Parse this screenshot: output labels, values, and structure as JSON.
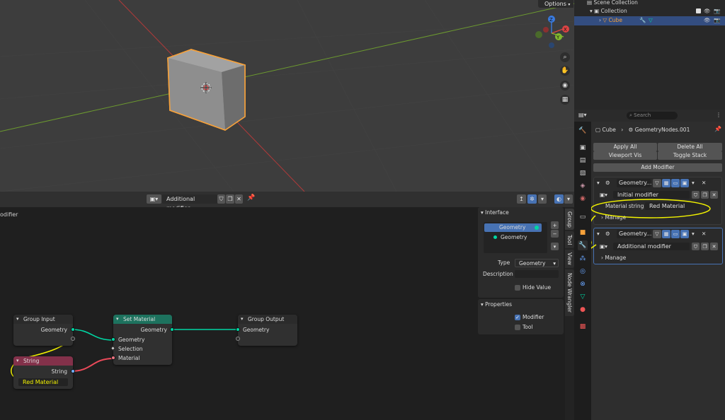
{
  "viewport": {
    "options_label": "Options"
  },
  "gizmo": {
    "x": "X",
    "y": "Y",
    "z": "Z"
  },
  "node_editor_header": {
    "tree_name": "Additional modifier"
  },
  "node_editor": {
    "left_label": "odifier"
  },
  "nodes": {
    "group_input": {
      "title": "Group Input",
      "output": "Geometry"
    },
    "string": {
      "title": "String",
      "output": "String",
      "value": "Red Material"
    },
    "set_material": {
      "title": "Set Material",
      "out": "Geometry",
      "in_geometry": "Geometry",
      "in_selection": "Selection",
      "in_material": "Material"
    },
    "group_output": {
      "title": "Group Output",
      "in_geometry": "Geometry"
    }
  },
  "npanel": {
    "interface_title": "Interface",
    "items": [
      "Geometry",
      "Geometry"
    ],
    "type_label": "Type",
    "type_value": "Geometry",
    "description_label": "Description",
    "hide_value_label": "Hide Value",
    "properties_title": "Properties",
    "modifier_label": "Modifier",
    "tool_label": "Tool"
  },
  "ntabs": [
    "Group",
    "Tool",
    "View",
    "Node Wrangler"
  ],
  "outliner": {
    "scene_collection": "Scene Collection",
    "collection": "Collection",
    "cube": "Cube"
  },
  "properties": {
    "search_placeholder": "Search",
    "breadcrumb_object": "Cube",
    "breadcrumb_modifier": "GeometryNodes.001",
    "apply_all": "Apply All",
    "delete_all": "Delete All",
    "viewport_vis": "Viewport Vis",
    "toggle_stack": "Toggle Stack",
    "add_modifier": "Add Modifier",
    "mod1_name": "Geometry...",
    "mod1_tree": "Initial modifier",
    "material_string_label": "Material string",
    "material_string_value": "Red Material",
    "manage": "Manage",
    "mod2_name": "Geometry...",
    "mod2_tree": "Additional modifier",
    "manage2": "Manage"
  },
  "colors": {
    "accent_blue": "#4772b3",
    "selection_orange": "#f6a13a",
    "geometry_socket": "#00d6a3",
    "string_socket": "#70b2ff",
    "material_socket": "#eb7582",
    "set_material_header": "#1d725e",
    "string_header": "#83314a",
    "annotation_yellow": "#f2f200"
  }
}
